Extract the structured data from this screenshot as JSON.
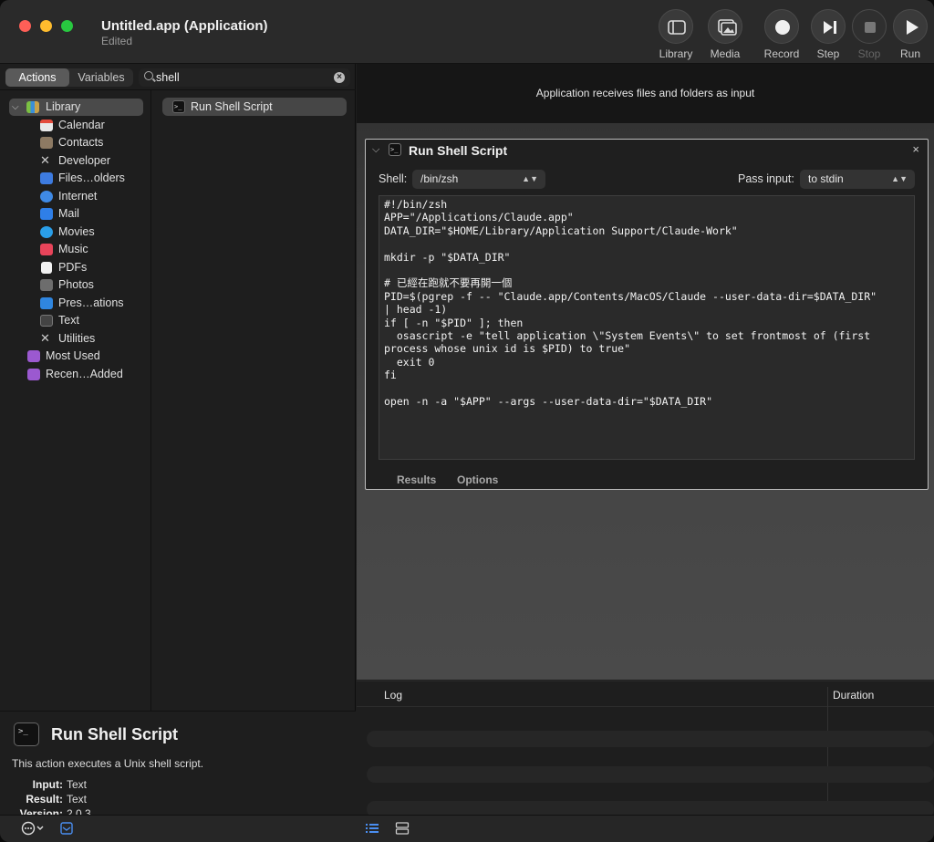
{
  "window": {
    "title": "Untitled.app (Application)",
    "subtitle": "Edited"
  },
  "toolbar": {
    "library": "Library",
    "media": "Media",
    "record": "Record",
    "step": "Step",
    "stop": "Stop",
    "run": "Run"
  },
  "left": {
    "tabs": {
      "actions": "Actions",
      "variables": "Variables"
    },
    "search": {
      "value": "shell"
    },
    "library_label": "Library",
    "categories": [
      "Calendar",
      "Contacts",
      "Developer",
      "Files…olders",
      "Internet",
      "Mail",
      "Movies",
      "Music",
      "PDFs",
      "Photos",
      "Pres…ations",
      "Text",
      "Utilities"
    ],
    "most_used": "Most Used",
    "recent": "Recen…Added",
    "results": [
      "Run Shell Script"
    ]
  },
  "description": {
    "name": "Run Shell Script",
    "body": "This action executes a Unix shell script.",
    "input_label": "Input:",
    "input_value": "Text",
    "result_label": "Result:",
    "result_value": "Text",
    "version_label": "Version:",
    "version_value": "2.0.3"
  },
  "workflow": {
    "receives": "Application receives files and folders as input",
    "action": {
      "title": "Run Shell Script",
      "shell_label": "Shell:",
      "shell_value": "/bin/zsh",
      "pass_label": "Pass input:",
      "pass_value": "to stdin",
      "script": "#!/bin/zsh\nAPP=\"/Applications/Claude.app\"\nDATA_DIR=\"$HOME/Library/Application Support/Claude-Work\"\n\nmkdir -p \"$DATA_DIR\"\n\n# 已經在跑就不要再開一個\nPID=$(pgrep -f -- \"Claude.app/Contents/MacOS/Claude --user-data-dir=$DATA_DIR\"\n| head -1)\nif [ -n \"$PID\" ]; then\n  osascript -e \"tell application \\\"System Events\\\" to set frontmost of (first\nprocess whose unix id is $PID) to true\"\n  exit 0\nfi\n\nopen -n -a \"$APP\" --args --user-data-dir=\"$DATA_DIR\"",
      "tab_results": "Results",
      "tab_options": "Options"
    }
  },
  "log": {
    "col_log": "Log",
    "col_duration": "Duration"
  }
}
